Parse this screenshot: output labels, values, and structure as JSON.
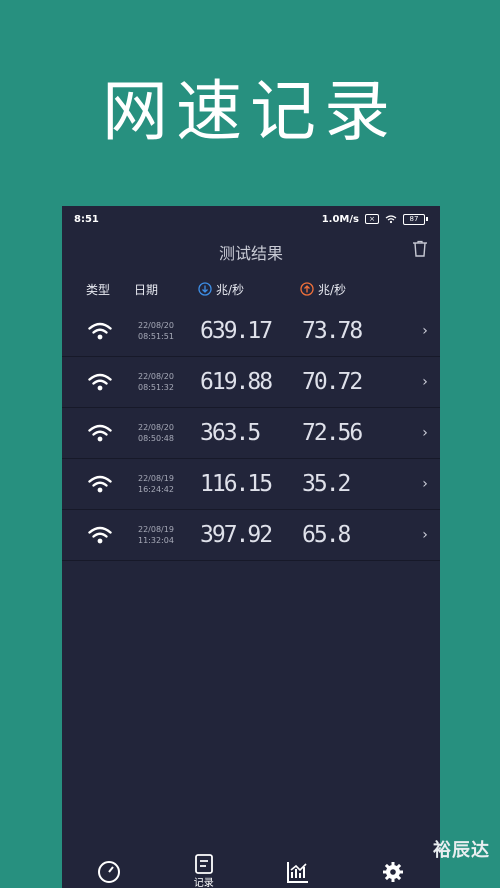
{
  "promo": {
    "title": "网速记录"
  },
  "status_bar": {
    "time": "8:51",
    "speed": "1.0M/s",
    "battery": "87"
  },
  "app_bar": {
    "title": "测试结果"
  },
  "columns": {
    "type": "类型",
    "date": "日期",
    "download": "兆/秒",
    "upload": "兆/秒"
  },
  "colors": {
    "download_icon": "#3d8ee6",
    "upload_icon": "#f0703a",
    "panel_bg": "#22253a",
    "page_bg": "#27907f"
  },
  "records": [
    {
      "type_icon": "wifi-icon",
      "date": "22/08/20",
      "time": "08:51:51",
      "download": "639.17",
      "upload": "73.78"
    },
    {
      "type_icon": "wifi-icon",
      "date": "22/08/20",
      "time": "08:51:32",
      "download": "619.88",
      "upload": "70.72"
    },
    {
      "type_icon": "wifi-icon",
      "date": "22/08/20",
      "time": "08:50:48",
      "download": "363.5",
      "upload": "72.56"
    },
    {
      "type_icon": "wifi-icon",
      "date": "22/08/19",
      "time": "16:24:42",
      "download": "116.15",
      "upload": "35.2"
    },
    {
      "type_icon": "wifi-icon",
      "date": "22/08/19",
      "time": "11:32:04",
      "download": "397.92",
      "upload": "65.8"
    }
  ],
  "row_arrow": "›",
  "bottom_nav": [
    {
      "icon": "speedometer-icon",
      "label": ""
    },
    {
      "icon": "record-icon",
      "label": "记录"
    },
    {
      "icon": "chart-icon",
      "label": ""
    },
    {
      "icon": "gear-icon",
      "label": ""
    }
  ],
  "watermark": "裕辰达"
}
